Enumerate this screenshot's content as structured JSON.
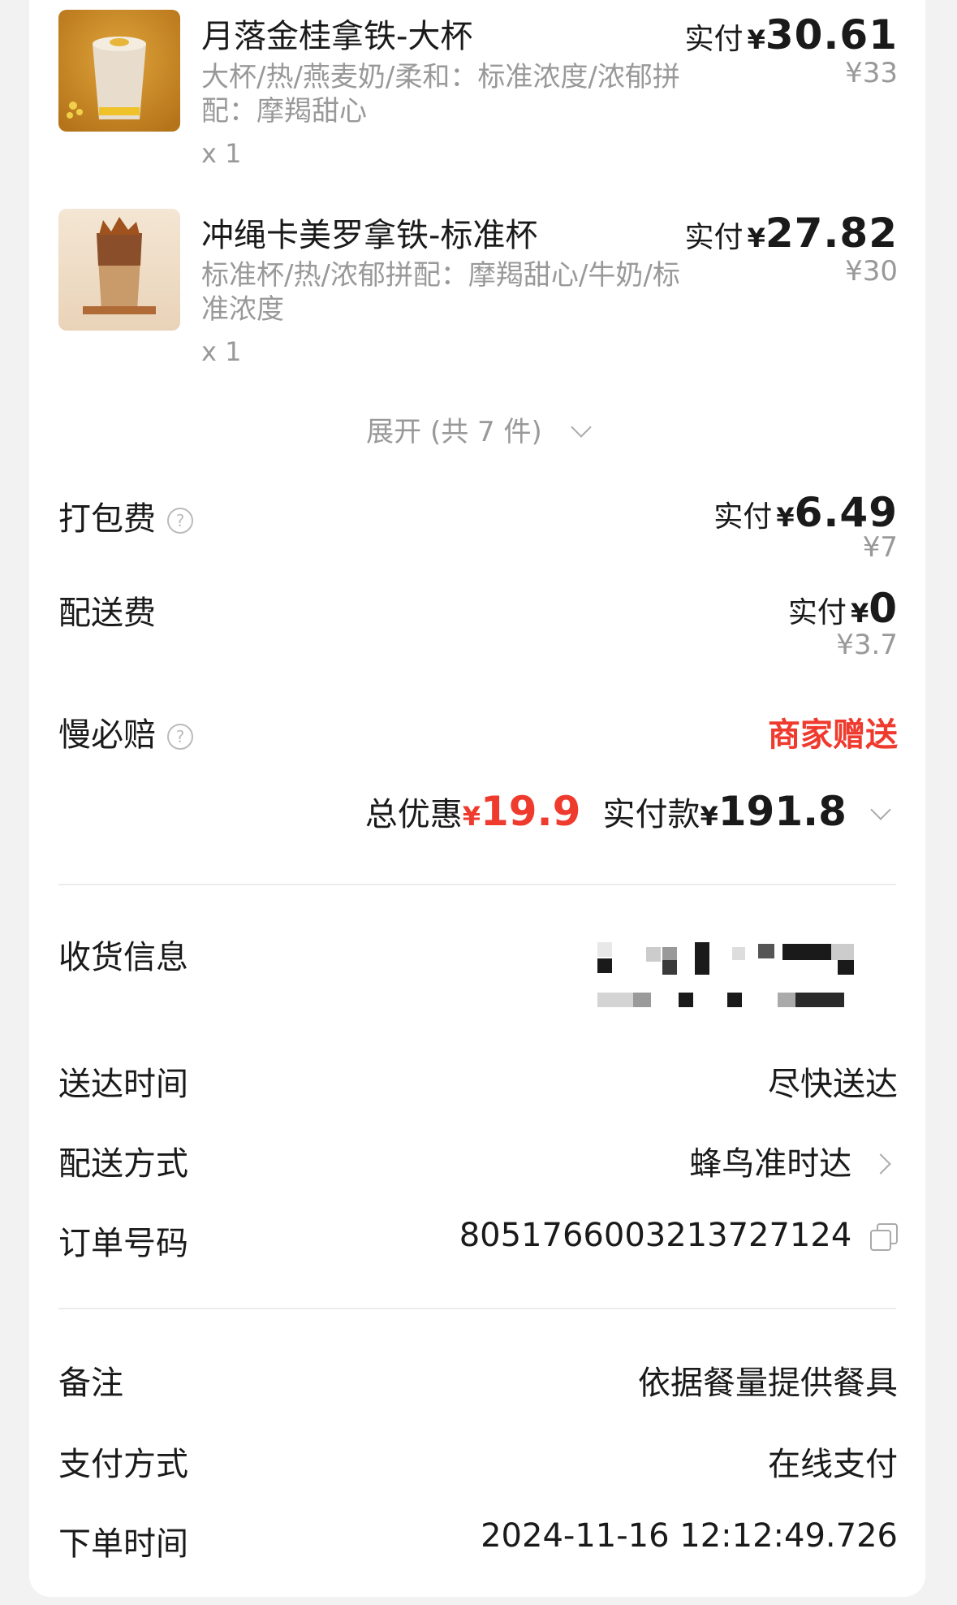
{
  "products": [
    {
      "name": "月落金桂拿铁-大杯",
      "specs": "大杯/热/燕麦奶/柔和：标准浓度/浓郁拼配：摩羯甜心",
      "qty": "x 1",
      "paid_label": "实付",
      "currency": "¥",
      "paid_amount": "30.61",
      "original_price": "¥33"
    },
    {
      "name": "冲绳卡美罗拿铁-标准杯",
      "specs": "标准杯/热/浓郁拼配：摩羯甜心/牛奶/标准浓度",
      "qty": "x 1",
      "paid_label": "实付",
      "currency": "¥",
      "paid_amount": "27.82",
      "original_price": "¥30"
    }
  ],
  "expand_label": "展开 (共 7 件)",
  "fees": {
    "packing": {
      "label": "打包费",
      "paid_label": "实付",
      "currency": "¥",
      "amount": "6.49",
      "original": "¥7"
    },
    "delivery": {
      "label": "配送费",
      "paid_label": "实付",
      "currency": "¥",
      "amount": "0",
      "original": "¥3.7"
    },
    "slow_compensation": {
      "label": "慢必赔",
      "value": "商家赠送"
    }
  },
  "summary": {
    "discount_label": "总优惠",
    "discount_currency": "¥",
    "discount_amount": "19.9",
    "paid_label": "实付款",
    "paid_currency": "¥",
    "paid_amount": "191.8"
  },
  "delivery_info": {
    "receiver_label": "收货信息",
    "time_label": "送达时间",
    "time_value": "尽快送达",
    "method_label": "配送方式",
    "method_value": "蜂鸟准时达",
    "order_label": "订单号码",
    "order_value": "8051766003213727124"
  },
  "order_info": {
    "note_label": "备注",
    "note_value": "依据餐量提供餐具",
    "payment_label": "支付方式",
    "payment_value": "在线支付",
    "time_label": "下单时间",
    "time_value": "2024-11-16 12:12:49.726"
  },
  "colors": {
    "accent_red": "#ef3a2e",
    "muted_gray": "#999999",
    "background": "#f2f2f2"
  }
}
